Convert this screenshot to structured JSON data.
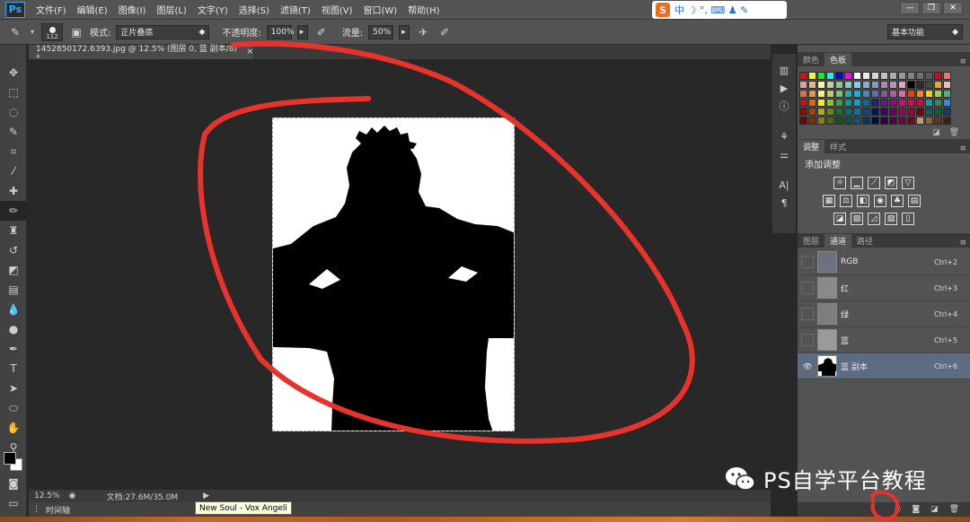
{
  "menubar": {
    "logo": "Ps",
    "items": [
      "文件(F)",
      "编辑(E)",
      "图像(I)",
      "图层(L)",
      "文字(Y)",
      "选择(S)",
      "滤镜(T)",
      "视图(V)",
      "窗口(W)",
      "帮助(H)"
    ],
    "ime": {
      "logo": "S",
      "label": "中 ☽ °, ⌨ ♟ ✎"
    },
    "window_controls": [
      "—",
      "❐",
      "✕"
    ]
  },
  "options": {
    "brush_size": "112",
    "mode_label": "模式:",
    "mode_value": "正片叠底",
    "opacity_label": "不透明度:",
    "opacity_value": "100%",
    "flow_label": "流量:",
    "flow_value": "50%",
    "workspace": "基本功能"
  },
  "document": {
    "tab_title": "1452850172.6393.jpg @ 12.5% (图层 0, 蓝 副本/8) *",
    "close": "×"
  },
  "status": {
    "zoom": "12.5%",
    "doc_info": "文档:27.6M/35.0M",
    "timeline": "时间轴",
    "tooltip": "New Soul - Vox Angeli"
  },
  "panels": {
    "swatch_tabs": [
      "颜色",
      "色板"
    ],
    "adjust_tabs": [
      "调整",
      "样式"
    ],
    "adjust_title": "添加调整",
    "layer_tabs": [
      "图层",
      "通道",
      "路径"
    ],
    "channels": [
      {
        "name": "RGB",
        "shortcut": "Ctrl+2",
        "selected": false
      },
      {
        "name": "红",
        "shortcut": "Ctrl+3",
        "selected": false
      },
      {
        "name": "绿",
        "shortcut": "Ctrl+4",
        "selected": false
      },
      {
        "name": "蓝",
        "shortcut": "Ctrl+5",
        "selected": false
      },
      {
        "name": "蓝 副本",
        "shortcut": "Ctrl+6",
        "selected": true
      }
    ]
  },
  "watermark": {
    "text": "PS自学平台教程"
  },
  "colors": {
    "annotation": "#e8322c",
    "selected_channel": "#5d6c83",
    "panel_bg": "#535353"
  }
}
